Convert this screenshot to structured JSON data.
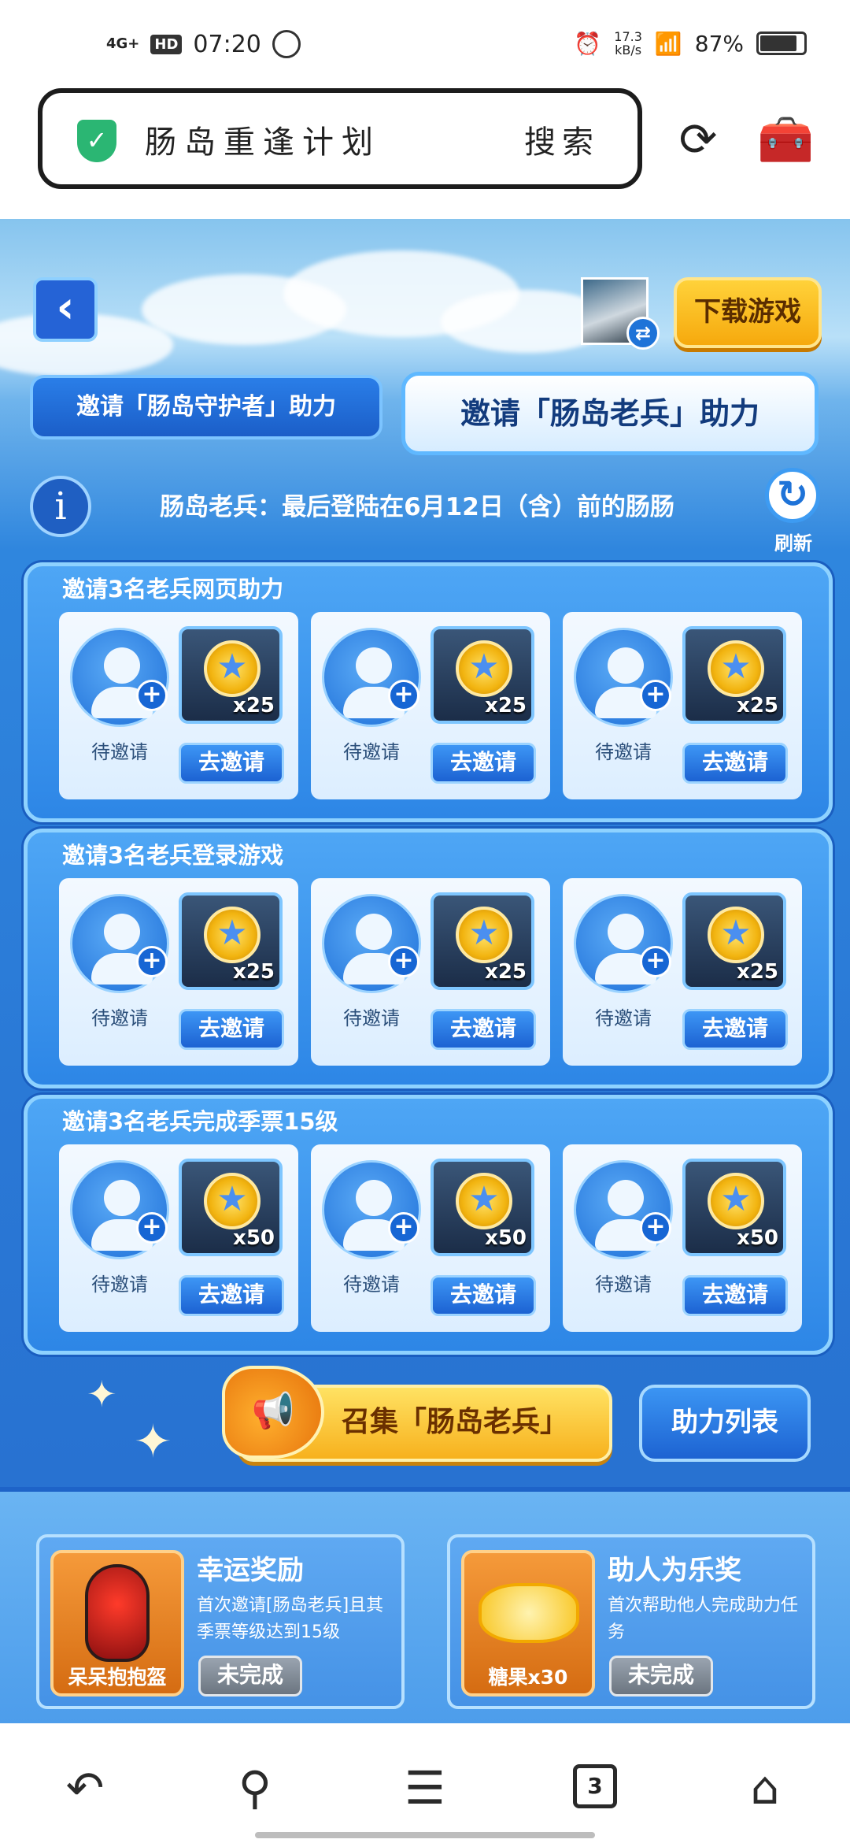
{
  "status_bar": {
    "network": "4G+",
    "hd": "HD",
    "time": "07:20",
    "speed_top": "17.3",
    "speed_unit": "kB/s",
    "battery": "87%"
  },
  "browser": {
    "url_text": "肠岛重逢计划",
    "search_label": "搜索",
    "refresh_icon": "refresh-icon",
    "toolbox_icon": "toolbox-icon"
  },
  "game": {
    "download_label": "下载游戏",
    "tabs": [
      {
        "label": "邀请「肠岛守护者」助力"
      },
      {
        "label": "邀请「肠岛老兵」助力"
      }
    ],
    "announcement": "肠岛老兵：最后登陆在6月12日（含）前的肠肠",
    "refresh_label": "刷新",
    "sections": [
      {
        "title": "邀请3名老兵网页助力",
        "slots": [
          {
            "status": "待邀请",
            "reward": "x25",
            "button": "去邀请"
          },
          {
            "status": "待邀请",
            "reward": "x25",
            "button": "去邀请"
          },
          {
            "status": "待邀请",
            "reward": "x25",
            "button": "去邀请"
          }
        ]
      },
      {
        "title": "邀请3名老兵登录游戏",
        "slots": [
          {
            "status": "待邀请",
            "reward": "x25",
            "button": "去邀请"
          },
          {
            "status": "待邀请",
            "reward": "x25",
            "button": "去邀请"
          },
          {
            "status": "待邀请",
            "reward": "x25",
            "button": "去邀请"
          }
        ]
      },
      {
        "title": "邀请3名老兵完成季票15级",
        "slots": [
          {
            "status": "待邀请",
            "reward": "x50",
            "button": "去邀请"
          },
          {
            "status": "待邀请",
            "reward": "x50",
            "button": "去邀请"
          },
          {
            "status": "待邀请",
            "reward": "x50",
            "button": "去邀请"
          }
        ]
      }
    ],
    "gather_label": "召集「肠岛老兵」",
    "help_list_label": "助力列表",
    "rewards": [
      {
        "title": "幸运奖励",
        "desc": "首次邀请[肠岛老兵]且其季票等级达到15级",
        "prize": "呆呆抱抱盔",
        "status": "未完成"
      },
      {
        "title": "助人为乐奖",
        "desc": "首次帮助他人完成助力任务",
        "prize": "糖果x30",
        "status": "未完成"
      }
    ]
  },
  "bottom_nav": {
    "tab_count": "3"
  },
  "colors": {
    "accent_blue": "#2a79d6",
    "gold": "#f7b11d",
    "shield_green": "#2bb673"
  }
}
